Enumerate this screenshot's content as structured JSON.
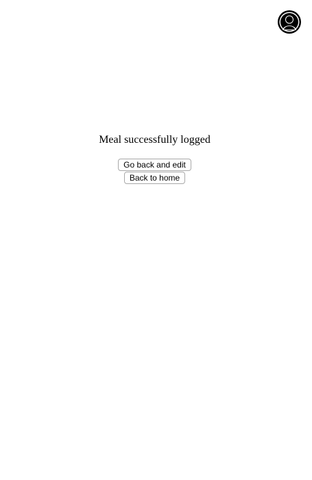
{
  "header": {
    "profile_icon": "user-avatar-icon"
  },
  "main": {
    "message": "Meal successfully logged",
    "edit_button_label": "Go back and edit",
    "home_button_label": "Back to home"
  },
  "colors": {
    "background": "#ffffff",
    "text": "#000000",
    "avatar": "#000000"
  }
}
